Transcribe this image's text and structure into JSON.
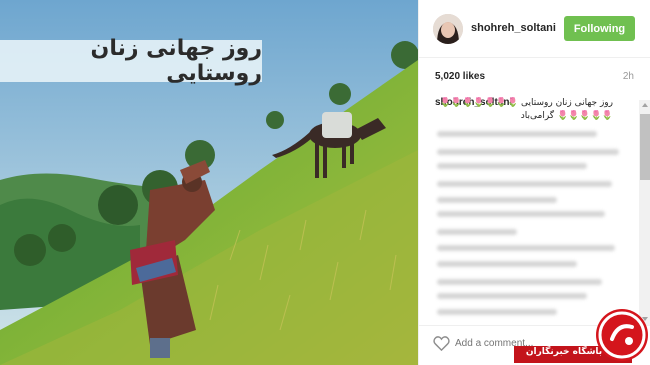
{
  "photo": {
    "caption": "روز جهانی زنان روستایی"
  },
  "post_header": {
    "username": "shohreh_soltani",
    "follow_label": "Following"
  },
  "stats": {
    "likes": "5,020 likes",
    "time": "2h"
  },
  "caption_comment": {
    "username": "shohreh_soltani",
    "text": "روز جهانی زنان روستایی 🌷🌷🌷🌷🌷🌷🌷🌷🌷🌷🌷🌷 گرامی‌باد"
  },
  "footer": {
    "comment_placeholder": "Add a comment..."
  },
  "watermark": {
    "text": "باشگاه خبرنگاران"
  },
  "colors": {
    "follow_button": "#70c050",
    "watermark_red": "#c3141b"
  },
  "icons": [
    "heart-icon",
    "avatar",
    "scroll-up-arrow-icon",
    "scroll-down-arrow-icon",
    "watermark-logo-icon"
  ]
}
